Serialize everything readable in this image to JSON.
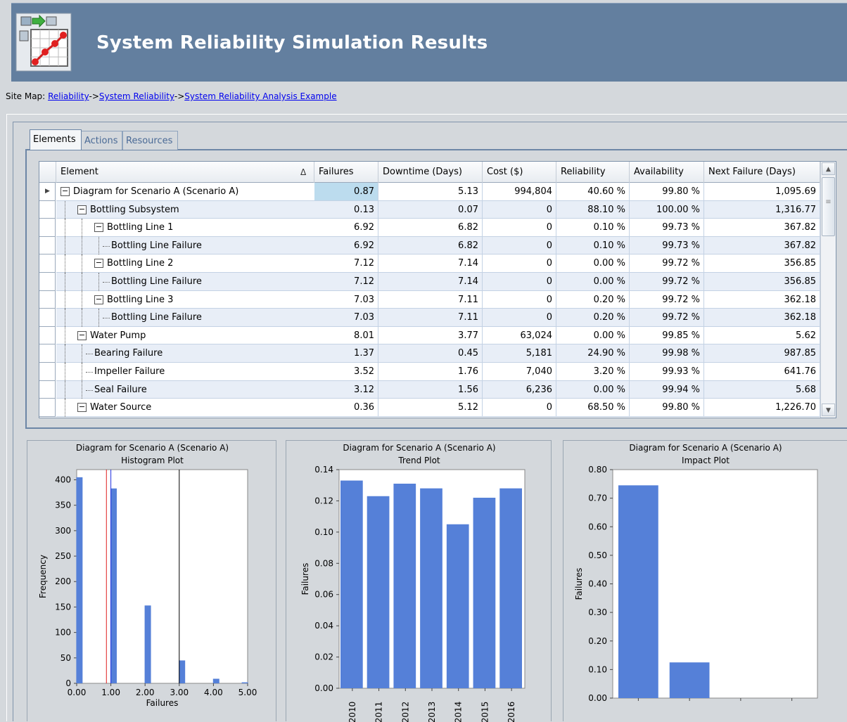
{
  "header": {
    "title": "System Reliability Simulation Results",
    "icon": "reliability-diagram-icon"
  },
  "sitemap": {
    "label": "Site Map:",
    "links": [
      "Reliability",
      "System Reliability",
      "System Reliability Analysis Example"
    ],
    "separator": "->"
  },
  "tabs": [
    "Elements",
    "Actions",
    "Resources"
  ],
  "active_tab": "Elements",
  "grid": {
    "columns": [
      "Element",
      "Failures",
      "Downtime (Days)",
      "Cost ($)",
      "Reliability",
      "Availability",
      "Next Failure (Days)"
    ],
    "sort_indicator": "Δ",
    "rows": [
      {
        "name": "Diagram for Scenario A (Scenario A)",
        "failures": "0.87",
        "downtime": "5.13",
        "cost": "994,804",
        "reliability": "40.60 %",
        "availability": "99.80 %",
        "next_failure": "1,095.69"
      },
      {
        "name": "Bottling Subsystem",
        "failures": "0.13",
        "downtime": "0.07",
        "cost": "0",
        "reliability": "88.10 %",
        "availability": "100.00 %",
        "next_failure": "1,316.77"
      },
      {
        "name": "Bottling Line 1",
        "failures": "6.92",
        "downtime": "6.82",
        "cost": "0",
        "reliability": "0.10 %",
        "availability": "99.73 %",
        "next_failure": "367.82"
      },
      {
        "name": "Bottling Line Failure",
        "failures": "6.92",
        "downtime": "6.82",
        "cost": "0",
        "reliability": "0.10 %",
        "availability": "99.73 %",
        "next_failure": "367.82"
      },
      {
        "name": "Bottling Line 2",
        "failures": "7.12",
        "downtime": "7.14",
        "cost": "0",
        "reliability": "0.00 %",
        "availability": "99.72 %",
        "next_failure": "356.85"
      },
      {
        "name": "Bottling Line Failure",
        "failures": "7.12",
        "downtime": "7.14",
        "cost": "0",
        "reliability": "0.00 %",
        "availability": "99.72 %",
        "next_failure": "356.85"
      },
      {
        "name": "Bottling Line 3",
        "failures": "7.03",
        "downtime": "7.11",
        "cost": "0",
        "reliability": "0.20 %",
        "availability": "99.72 %",
        "next_failure": "362.18"
      },
      {
        "name": "Bottling Line Failure",
        "failures": "7.03",
        "downtime": "7.11",
        "cost": "0",
        "reliability": "0.20 %",
        "availability": "99.72 %",
        "next_failure": "362.18"
      },
      {
        "name": "Water Pump",
        "failures": "8.01",
        "downtime": "3.77",
        "cost": "63,024",
        "reliability": "0.00 %",
        "availability": "99.85 %",
        "next_failure": "5.62"
      },
      {
        "name": "Bearing Failure",
        "failures": "1.37",
        "downtime": "0.45",
        "cost": "5,181",
        "reliability": "24.90 %",
        "availability": "99.98 %",
        "next_failure": "987.85"
      },
      {
        "name": "Impeller Failure",
        "failures": "3.52",
        "downtime": "1.76",
        "cost": "7,040",
        "reliability": "3.20 %",
        "availability": "99.93 %",
        "next_failure": "641.76"
      },
      {
        "name": "Seal Failure",
        "failures": "3.12",
        "downtime": "1.56",
        "cost": "6,236",
        "reliability": "0.00 %",
        "availability": "99.94 %",
        "next_failure": "5.68"
      },
      {
        "name": "Water Source",
        "failures": "0.36",
        "downtime": "5.12",
        "cost": "0",
        "reliability": "68.50 %",
        "availability": "99.80 %",
        "next_failure": "1,226.70"
      }
    ]
  },
  "colors": {
    "header_band": "#637f9f",
    "bar": "#5580d8",
    "mean_line": "#e02020",
    "median_line": "#2030e0",
    "selected_cell": "#bcdcee"
  },
  "chart_data": [
    {
      "type": "bar",
      "title": "Diagram for Scenario A (Scenario A)",
      "subtitle": "Histogram Plot",
      "xlabel": "Failures",
      "ylabel": "Frequency",
      "xlim": [
        0,
        5
      ],
      "ylim": [
        0,
        420
      ],
      "x_ticks": [
        "0.00",
        "1.00",
        "2.00",
        "3.00",
        "4.00",
        "5.00"
      ],
      "y_ticks": [
        "0",
        "50",
        "100",
        "150",
        "200",
        "250",
        "300",
        "350",
        "400"
      ],
      "bins": [
        {
          "x": 0.08,
          "value": 405
        },
        {
          "x": 1.08,
          "value": 383
        },
        {
          "x": 2.08,
          "value": 153
        },
        {
          "x": 3.08,
          "value": 45
        },
        {
          "x": 4.08,
          "value": 9
        },
        {
          "x": 4.92,
          "value": 2
        }
      ],
      "reference_lines": [
        {
          "x": 0.87,
          "color": "#e02020"
        },
        {
          "x": 1.0,
          "color": "#2030e0"
        },
        {
          "x": 3.0,
          "color": "#000000"
        }
      ]
    },
    {
      "type": "bar",
      "title": "Diagram for Scenario A (Scenario A)",
      "subtitle": "Trend Plot",
      "xlabel": "",
      "ylabel": "Failures",
      "ylim": [
        0,
        0.14
      ],
      "y_ticks": [
        "0.00",
        "0.02",
        "0.04",
        "0.06",
        "0.08",
        "0.10",
        "0.12",
        "0.14"
      ],
      "categories": [
        "2010",
        "2011",
        "2012",
        "2013",
        "2014",
        "2015",
        "2016"
      ],
      "values": [
        0.133,
        0.123,
        0.131,
        0.128,
        0.105,
        0.122,
        0.128
      ]
    },
    {
      "type": "bar",
      "title": "Diagram for Scenario A (Scenario A)",
      "subtitle": "Impact Plot",
      "xlabel": "",
      "ylabel": "Failures",
      "ylim": [
        0,
        0.8
      ],
      "y_ticks": [
        "0.00",
        "0.10",
        "0.20",
        "0.30",
        "0.40",
        "0.50",
        "0.60",
        "0.70",
        "0.80"
      ],
      "categories": [
        "",
        "",
        "",
        ""
      ],
      "values": [
        0.745,
        0.125,
        0,
        0
      ]
    }
  ]
}
